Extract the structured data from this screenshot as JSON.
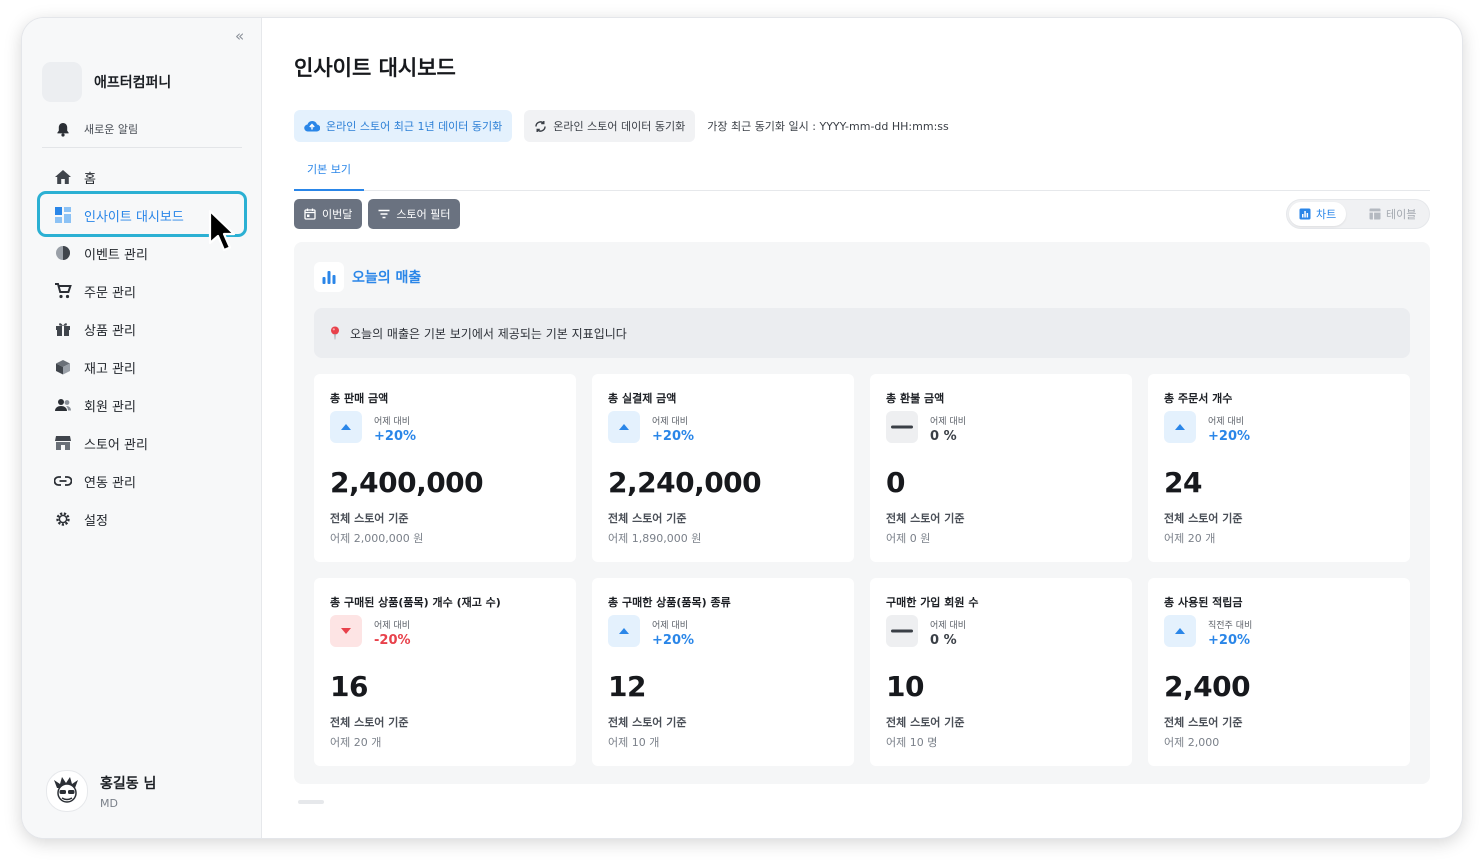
{
  "sidebar": {
    "company": "애프터컴퍼니",
    "notification": "새로운 알림",
    "items": [
      {
        "label": "홈",
        "icon": "home-icon"
      },
      {
        "label": "인사이트 대시보드",
        "icon": "dashboard-icon"
      },
      {
        "label": "이벤트 관리",
        "icon": "pie-icon"
      },
      {
        "label": "주문 관리",
        "icon": "cart-icon"
      },
      {
        "label": "상품 관리",
        "icon": "gift-icon"
      },
      {
        "label": "재고 관리",
        "icon": "box-icon"
      },
      {
        "label": "회원 관리",
        "icon": "users-icon"
      },
      {
        "label": "스토어 관리",
        "icon": "store-icon"
      },
      {
        "label": "연동 관리",
        "icon": "link-icon"
      },
      {
        "label": "설정",
        "icon": "gear-icon"
      }
    ],
    "user": {
      "name": "홍길동 님",
      "role": "MD"
    }
  },
  "header": {
    "title": "인사이트 대시보드",
    "sync_year": "온라인 스토어 최근 1년 데이터 동기화",
    "sync": "온라인 스토어 데이터 동기화",
    "last_sync": "가장 최근 동기화 일시 : YYYY-mm-dd HH:mm:ss"
  },
  "tabs": {
    "basic": "기본 보기"
  },
  "filters": {
    "month": "이번달",
    "store": "스토어 필터"
  },
  "view_toggle": {
    "chart": "차트",
    "table": "테이블"
  },
  "panel": {
    "title": "오늘의 매출",
    "notice": "오늘의 매출은 기본 보기에서 제공되는 기본 지표입니다"
  },
  "colors": {
    "accent": "#2a86e8",
    "down": "#e8414b",
    "highlight": "#2bb0d3"
  },
  "cards": [
    {
      "title": "총 판매 금액",
      "compare": "어제 대비",
      "pct": "+20%",
      "trend": "up",
      "value": "2,400,000",
      "basis": "전체 스토어 기준",
      "prev": "어제 2,000,000 원"
    },
    {
      "title": "총 실결제 금액",
      "compare": "어제 대비",
      "pct": "+20%",
      "trend": "up",
      "value": "2,240,000",
      "basis": "전체 스토어 기준",
      "prev": "어제 1,890,000 원"
    },
    {
      "title": "총 환불 금액",
      "compare": "어제 대비",
      "pct": "0 %",
      "trend": "flat",
      "value": "0",
      "basis": "전체 스토어 기준",
      "prev": "어제 0 원"
    },
    {
      "title": "총 주문서 개수",
      "compare": "어제 대비",
      "pct": "+20%",
      "trend": "up",
      "value": "24",
      "basis": "전체 스토어 기준",
      "prev": "어제 20 개"
    },
    {
      "title": "총 구매된 상품(품목) 개수 (재고 수)",
      "compare": "어제 대비",
      "pct": "-20%",
      "trend": "down",
      "value": "16",
      "basis": "전체 스토어 기준",
      "prev": "어제 20 개"
    },
    {
      "title": "총 구매한 상품(품목) 종류",
      "compare": "어제 대비",
      "pct": "+20%",
      "trend": "up",
      "value": "12",
      "basis": "전체 스토어 기준",
      "prev": "어제 10 개"
    },
    {
      "title": "구매한 가입 회원 수",
      "compare": "어제 대비",
      "pct": "0 %",
      "trend": "flat",
      "value": "10",
      "basis": "전체 스토어 기준",
      "prev": "어제 10 명"
    },
    {
      "title": "총 사용된 적립금",
      "compare": "직전주 대비",
      "pct": "+20%",
      "trend": "up",
      "value": "2,400",
      "basis": "전체 스토어 기준",
      "prev": "어제 2,000"
    }
  ]
}
